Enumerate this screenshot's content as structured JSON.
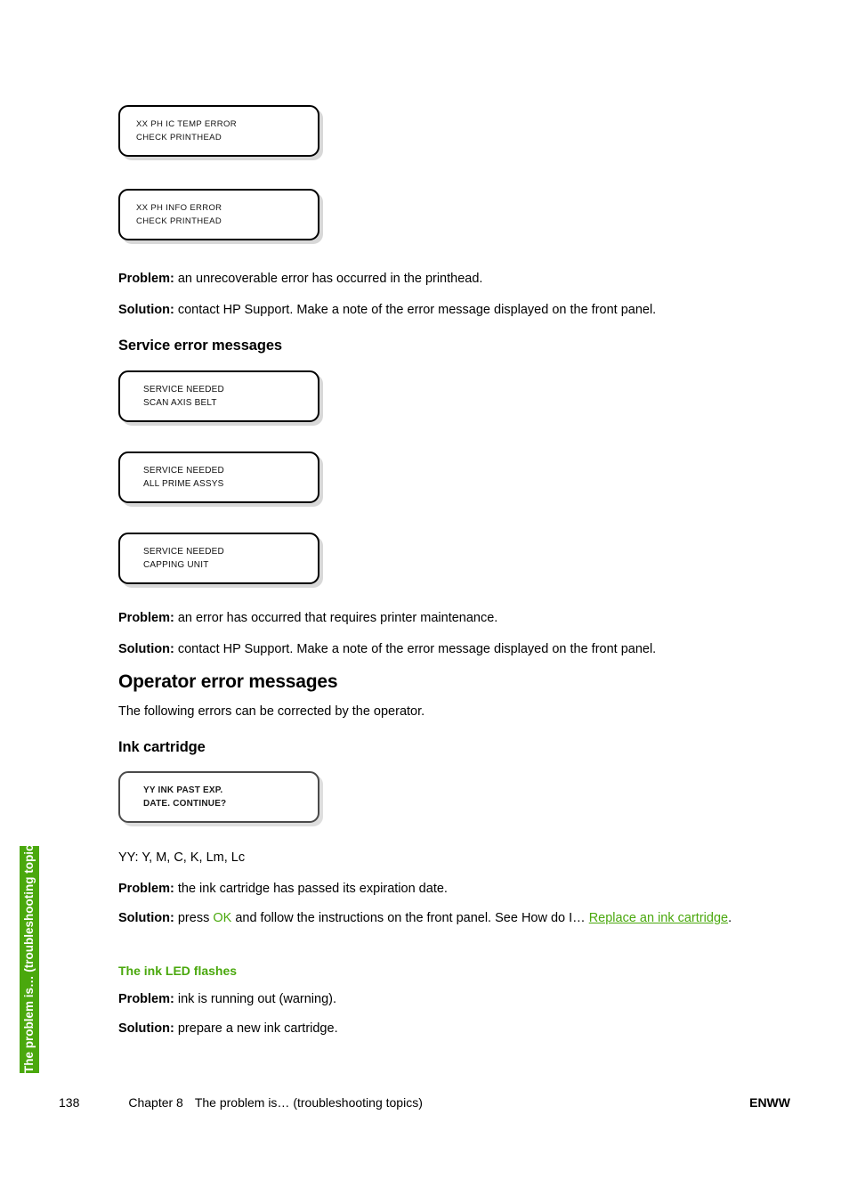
{
  "page": {
    "number": "138",
    "chapter": "Chapter 8",
    "chapter_title": "The problem is… (troubleshooting topics)",
    "locale_code": "ENWW"
  },
  "side_tab": {
    "label": "The problem is… (troubleshooting topics)",
    "color": "#4aa80d"
  },
  "printhead_panels": [
    {
      "line1": "XX PH IC TEMP ERROR",
      "line2": "CHECK PRINTHEAD"
    },
    {
      "line1": "XX PH INFO ERROR",
      "line2": "CHECK PRINTHEAD"
    }
  ],
  "printhead_error": {
    "problem_label": "Problem:",
    "problem_text": " an unrecoverable error has occurred in the printhead.",
    "solution_label": "Solution:",
    "solution_text": " contact HP Support. Make a note of the error message displayed on the front panel."
  },
  "service_section": {
    "heading": "Service error messages",
    "panels": [
      {
        "line1": "SERVICE NEEDED",
        "line2": "SCAN AXIS BELT"
      },
      {
        "line1": "SERVICE NEEDED",
        "line2": "ALL PRIME ASSYS"
      },
      {
        "line1": "SERVICE NEEDED",
        "line2": "CAPPING UNIT"
      }
    ],
    "problem_label": "Problem:",
    "problem_text": " an error has occurred that requires printer maintenance.",
    "solution_label": "Solution:",
    "solution_text": " contact HP Support. Make a note of the error message displayed on the front panel."
  },
  "operator_section": {
    "heading": "Operator error messages",
    "intro": "The following errors can be corrected by the operator.",
    "ink_cartridge": {
      "heading": "Ink cartridge",
      "panel": {
        "line1": "YY INK PAST EXP.",
        "line2": "DATE. CONTINUE?"
      },
      "legend": "YY: Y, M, C, K, Lm, Lc",
      "problem_label": "Problem:",
      "problem_text": " the ink cartridge has passed its expiration date.",
      "solution_label": "Solution:",
      "solution_text_1": " press ",
      "solution_key": "OK",
      "solution_text_2": " and follow the instructions on the front panel. See How do I… ",
      "solution_link": "Replace an ink cartridge",
      "solution_text_3": "."
    },
    "ink_led": {
      "heading": "The ink LED flashes",
      "problem_label": "Problem:",
      "problem_text": " ink is running out (warning).",
      "solution_label": "Solution:",
      "solution_text": " prepare a new ink cartridge."
    }
  }
}
